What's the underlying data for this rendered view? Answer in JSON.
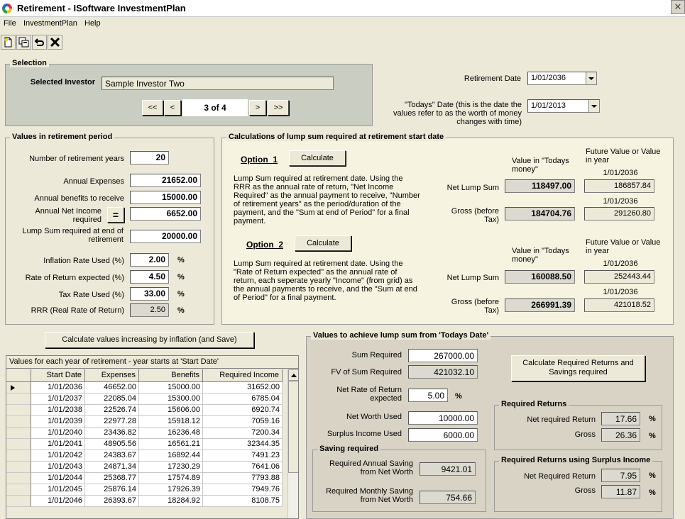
{
  "window": {
    "title": "Retirement - ISoftware InvestmentPlan"
  },
  "menu": [
    {
      "label": "File",
      "mnemonic": "F"
    },
    {
      "label": "InvestmentPlan",
      "mnemonic": "I"
    },
    {
      "label": "Help",
      "mnemonic": "H"
    }
  ],
  "toolbar": {
    "icons": [
      "new-document-icon",
      "copy-icon",
      "undo-icon",
      "delete-icon"
    ]
  },
  "selection": {
    "title": "Selection",
    "investor_label": "Selected Investor",
    "investor_value": "Sample Investor Two",
    "nav": {
      "first": "<<",
      "prev": "<",
      "record": "3 of 4",
      "next": ">",
      "last": ">>"
    }
  },
  "dates": {
    "retirement_label": "Retirement Date",
    "retirement_value": "1/01/2036",
    "today_label": "\"Todays\" Date (this is the date the values refer to as the worth of money changes with time)",
    "today_value": "1/01/2013"
  },
  "retirement": {
    "title": "Values in retirement period",
    "years_label": "Number of retirement years",
    "years_value": "20",
    "expenses_label": "Annual Expenses",
    "expenses_value": "21652.00",
    "benefits_label": "Annual benefits to receive",
    "benefits_value": "15000.00",
    "net_income_label": "Annual Net Income required",
    "net_income_value": "6652.00",
    "equals_label": "=",
    "lump_end_label": "Lump Sum required at end of retirement",
    "lump_end_value": "20000.00",
    "inflation_label": "Inflation Rate Used (%)",
    "inflation_value": "2.00",
    "return_label": "Rate of Return expected (%)",
    "return_value": "4.50",
    "tax_label": "Tax Rate Used (%)",
    "tax_value": "33.00",
    "rrr_label": "RRR (Real Rate of Return)",
    "rrr_value": "2.50",
    "percent": "%"
  },
  "lump": {
    "title": "Calculations of lump sum required at retirement start date",
    "calculate": "Calculate",
    "col_today": "Value in \"Todays money\"",
    "col_future": "Future Value or Value in year",
    "net_label": "Net Lump Sum",
    "gross_label": "Gross (before Tax)",
    "option1": {
      "label": "Option  1",
      "desc": "Lump Sum required at retirement date. Using the RRR as the annual rate of return, \"Net Income Required\" as the annual payment to receive, \"Number of retirement years\" as the period/duration of the payment, and the \"Sum at end of Period\" for a final payment.",
      "year_net": "1/01/2036",
      "year_gross": "1/01/2036",
      "net_today": "118497.00",
      "net_future": "186857.84",
      "gross_today": "184704.76",
      "gross_future": "291260.80"
    },
    "option2": {
      "label": "Option  2",
      "desc": "Lump Sum required at retirement date. Using the \"Rate of Return expected\" as the annual rate of return, each seperate yearly \"Income\" (from grid) as the annual payments to receive, and the \"Sum at end of Period\" for a final payment.",
      "year_net": "1/01/2036",
      "year_gross": "1/01/2036",
      "net_today": "160088.50",
      "net_future": "252443.44",
      "gross_today": "266991.39",
      "gross_future": "421018.52"
    }
  },
  "calc_inflation_button": "Calculate values increasing by inflation (and Save)",
  "grid": {
    "caption": "Values for each year of retirement - year starts at 'Start Date'",
    "columns": [
      "Start Date",
      "Expenses",
      "Benefits",
      "Required Income"
    ],
    "rows": [
      [
        "1/01/2036",
        "46652.00",
        "15000.00",
        "31652.00"
      ],
      [
        "1/01/2037",
        "22085.04",
        "15300.00",
        "6785.04"
      ],
      [
        "1/01/2038",
        "22526.74",
        "15606.00",
        "6920.74"
      ],
      [
        "1/01/2039",
        "22977.28",
        "15918.12",
        "7059.16"
      ],
      [
        "1/01/2040",
        "23436.82",
        "16236.48",
        "7200.34"
      ],
      [
        "1/01/2041",
        "48905.56",
        "16561.21",
        "32344.35"
      ],
      [
        "1/01/2042",
        "24383.67",
        "16892.44",
        "7491.23"
      ],
      [
        "1/01/2043",
        "24871.34",
        "17230.29",
        "7641.06"
      ],
      [
        "1/01/2044",
        "25368.77",
        "17574.89",
        "7793.88"
      ],
      [
        "1/01/2045",
        "25876.14",
        "17926.39",
        "7949.76"
      ],
      [
        "1/01/2046",
        "26393.67",
        "18284.92",
        "8108.75"
      ]
    ]
  },
  "achieve": {
    "title": "Values to achieve lump sum from 'Todays Date'",
    "sum_label": "Sum Required",
    "sum_value": "267000.00",
    "fv_label": "FV of Sum Required",
    "fv_value": "421032.10",
    "net_rate_label": "Net Rate of Return expected",
    "net_rate_value": "5.00",
    "net_worth_label": "Net Worth Used",
    "net_worth_value": "10000.00",
    "surplus_label": "Surplus Income Used",
    "surplus_value": "6000.00",
    "calc_button": "Calculate Required Returns and Savings required",
    "percent": "%",
    "req_returns": {
      "title": "Required Returns",
      "net_label": "Net required Return",
      "net_value": "17.66",
      "gross_label": "Gross",
      "gross_value": "26.36"
    },
    "saving": {
      "title": "Saving required",
      "annual_label": "Required Annual Saving from Net Worth",
      "annual_value": "9421.01",
      "monthly_label": "Required Monthly Saving from Net Worth",
      "monthly_value": "754.66"
    },
    "surplus_returns": {
      "title": "Required Returns using Surplus Income",
      "net_label": "Net Required Return",
      "net_value": "7.95",
      "gross_label": "Gross",
      "gross_value": "11.87"
    }
  }
}
